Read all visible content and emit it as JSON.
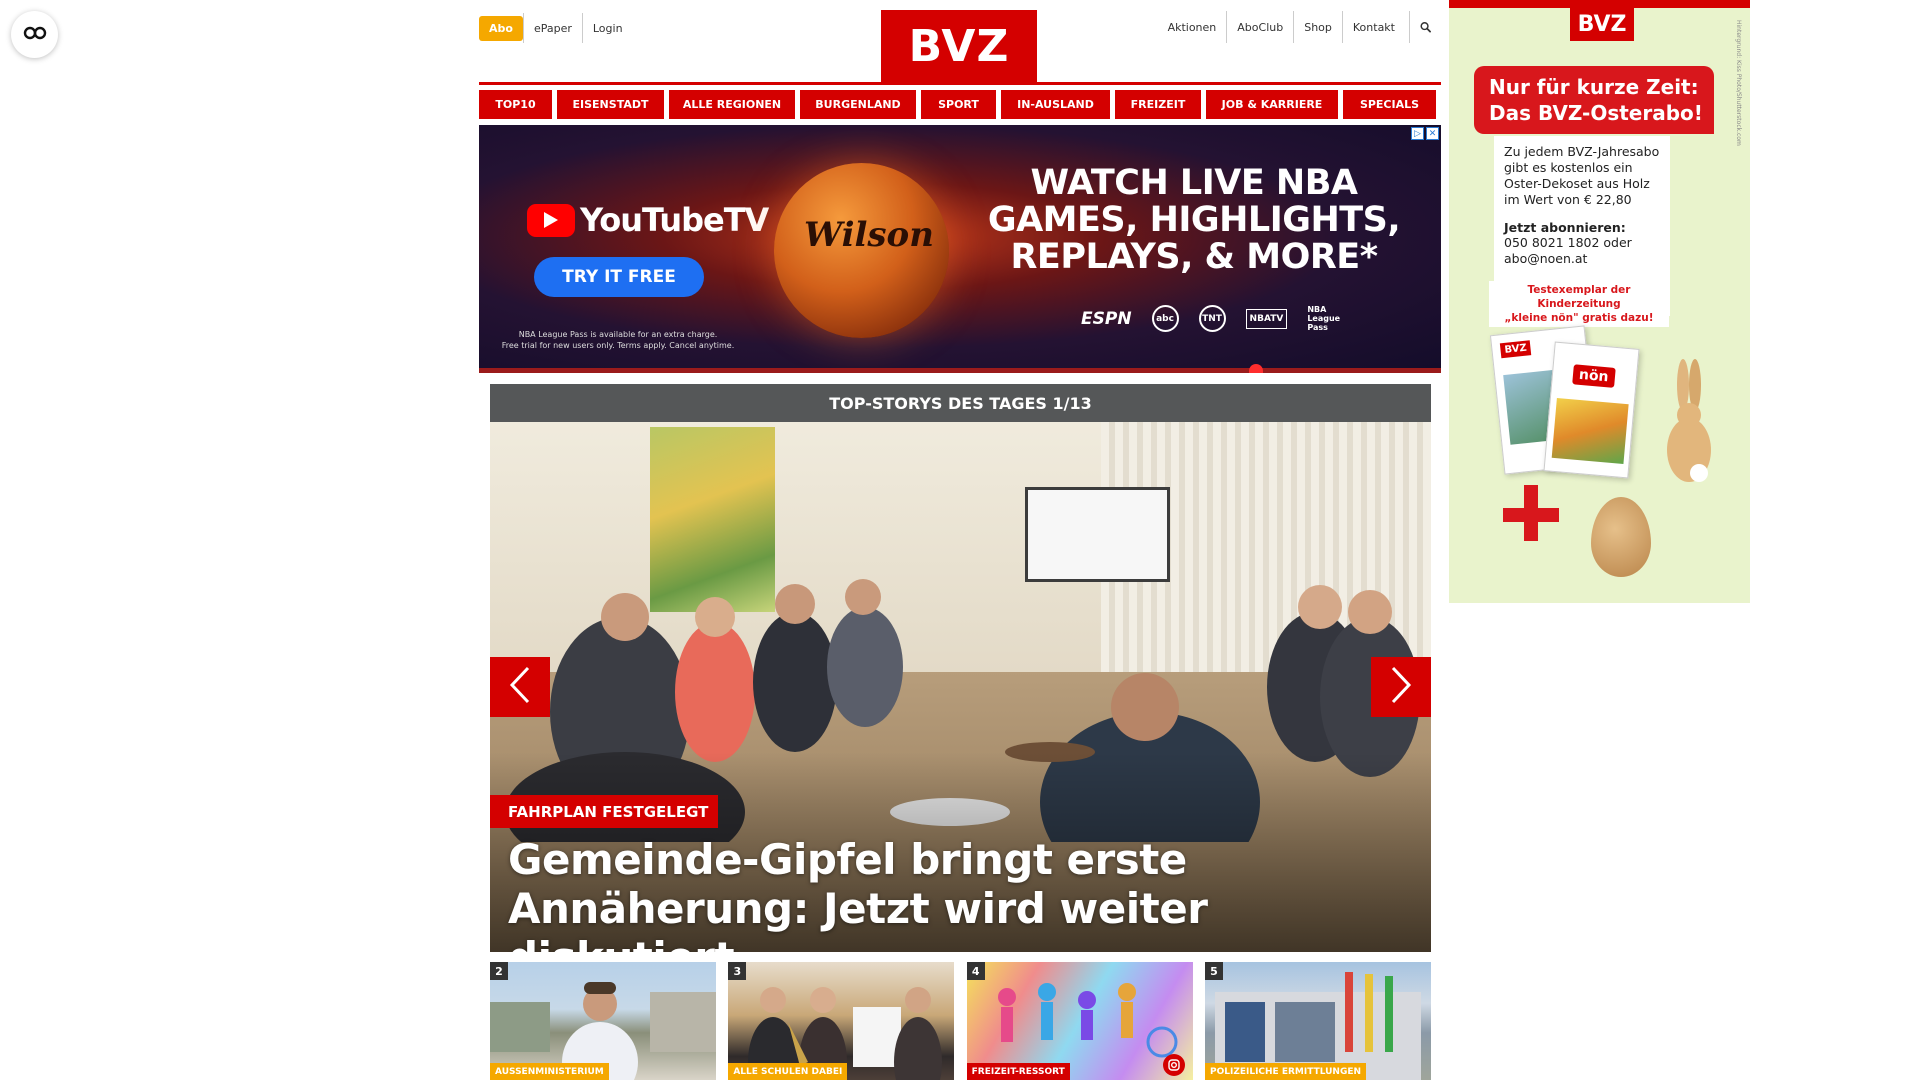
{
  "accessibility": {
    "icon": "glasses-icon"
  },
  "header": {
    "abo_label": "Abo",
    "left_links": [
      "ePaper",
      "Login"
    ],
    "logo_text": "BVZ",
    "right_links": [
      "Aktionen",
      "AboClub",
      "Shop",
      "Kontakt"
    ],
    "search_icon": "search-icon",
    "brand_color": "#d40000",
    "abo_color": "#f5a800"
  },
  "nav": {
    "items": [
      "TOP10",
      "EISENSTADT",
      "ALLE REGIONEN",
      "BURGENLAND",
      "SPORT",
      "IN-AUSLAND",
      "FREIZEIT",
      "JOB & KARRIERE",
      "SPECIALS"
    ]
  },
  "ad": {
    "brand": "YouTubeTV",
    "cta": "TRY IT FREE",
    "fine_print_1": "NBA League Pass is available for an extra charge.",
    "fine_print_2": "Free trial for new users only. Terms apply. Cancel anytime.",
    "ball_brand": "Wilson",
    "headline_1": "WATCH LIVE NBA",
    "headline_2": "GAMES, HIGHLIGHTS,",
    "headline_3": "REPLAYS, & MORE*",
    "networks": [
      "ESPN",
      "abc",
      "TNT",
      "NBATV",
      "NBA League Pass"
    ]
  },
  "carousel": {
    "heading": "TOP-STORYS DES TAGES 1/13",
    "kicker": "FAHRPLAN FESTGELEGT",
    "title": "Gemeinde-Gipfel bringt erste Annäherung: Jetzt wird weiter diskutiert",
    "prev_icon": "chevron-left-icon",
    "next_icon": "chevron-right-icon"
  },
  "thumbs": [
    {
      "num": "2",
      "category": "AUSSENMINISTERIUM"
    },
    {
      "num": "3",
      "category": "ALLE SCHULEN DABEI"
    },
    {
      "num": "4",
      "category": "FREIZEIT-RESSORT"
    },
    {
      "num": "5",
      "category": "POLIZEILICHE ERMITTLUNGEN"
    }
  ],
  "side_ad": {
    "logo": "BVZ",
    "banner_1": "Nur für kurze Zeit:",
    "banner_2": "Das BVZ-Osterabo!",
    "body": "Zu jedem BVZ-Jahresabo gibt es kostenlos ein Oster-Dekoset aus Holz im Wert von € 22,80",
    "subhead": "Jetzt abonnieren:",
    "contact_1": "050 8021 1802 oder",
    "contact_2": "abo@noen.at",
    "note_1": "Testexemplar der Kinderzeitung",
    "note_2": "„kleine nön\" gratis dazu!",
    "paper_logo_1": "BVZ",
    "paper_logo_2": "nön",
    "vertical_credit": "Hintergrund: Kiss Photo/Shutterstock.com"
  }
}
